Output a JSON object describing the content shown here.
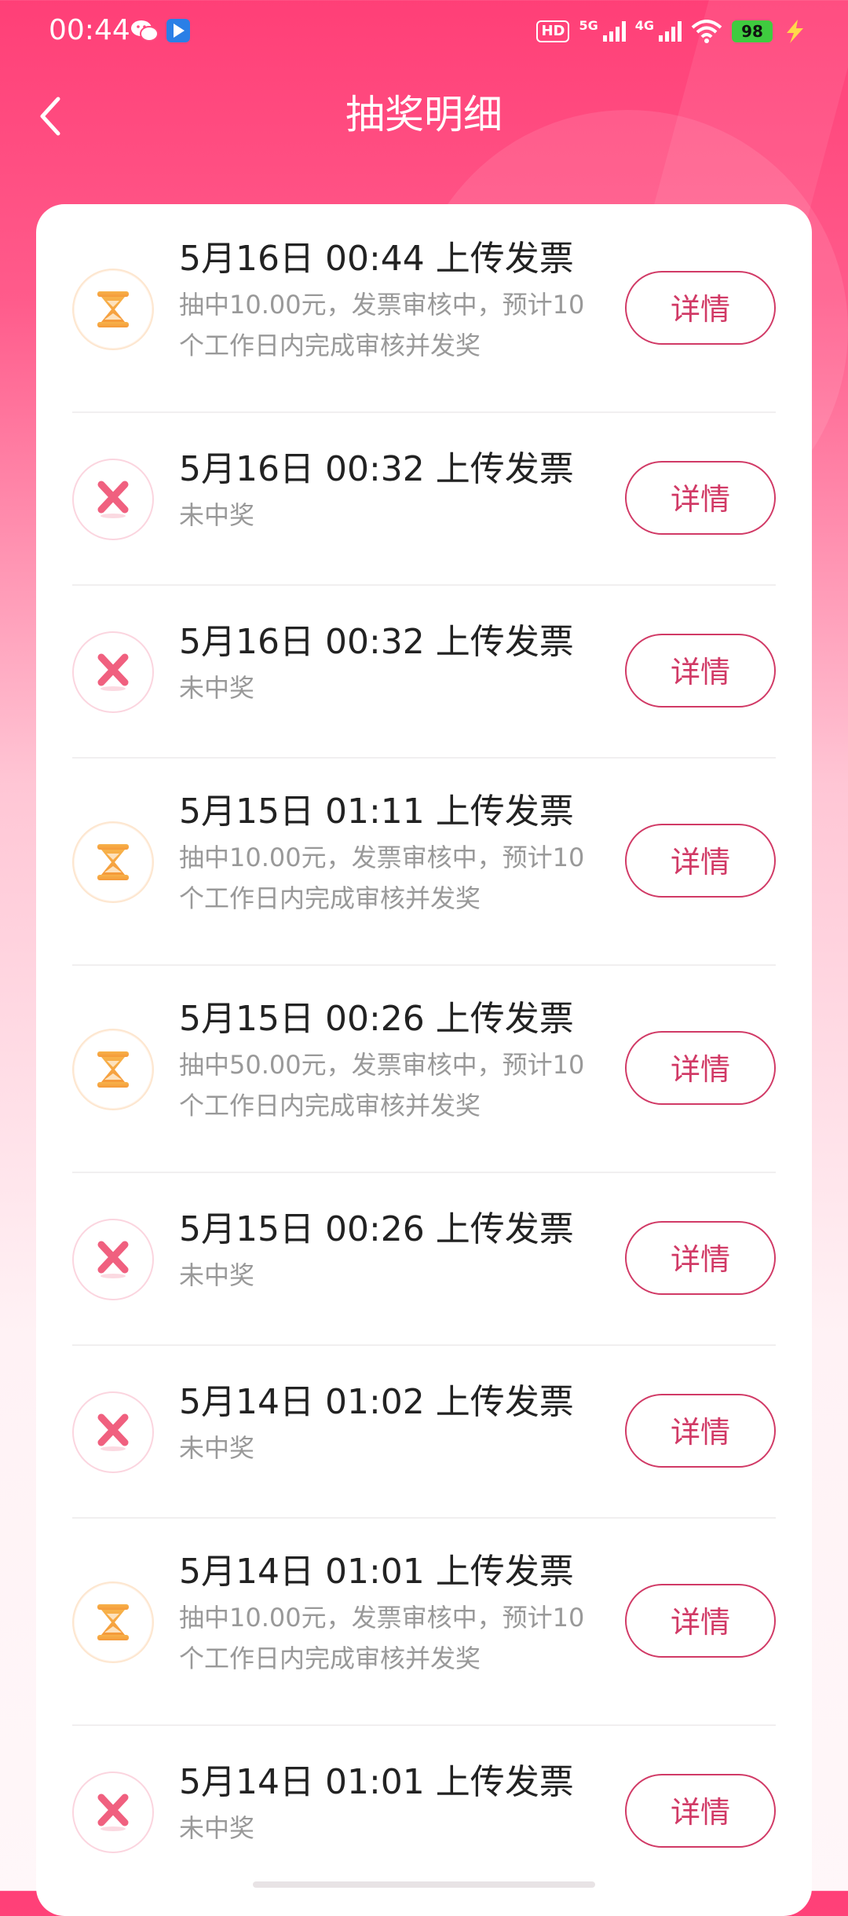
{
  "status_bar": {
    "time": "00:44",
    "net1": "5G",
    "net2": "4G",
    "battery": "98",
    "hd": "HD"
  },
  "nav": {
    "title": "抽奖明细"
  },
  "records": [
    {
      "title": "5月16日 00:44 上传发票",
      "status": "pending",
      "desc": "抽中10.00元，发票审核中，预计10个工作日内完成审核并发奖",
      "button": "详情"
    },
    {
      "title": "5月16日 00:32 上传发票",
      "status": "lost",
      "desc": "未中奖",
      "button": "详情"
    },
    {
      "title": "5月16日 00:32 上传发票",
      "status": "lost",
      "desc": "未中奖",
      "button": "详情"
    },
    {
      "title": "5月15日 01:11 上传发票",
      "status": "pending",
      "desc": "抽中10.00元，发票审核中，预计10个工作日内完成审核并发奖",
      "button": "详情"
    },
    {
      "title": "5月15日 00:26 上传发票",
      "status": "pending",
      "desc": "抽中50.00元，发票审核中，预计10个工作日内完成审核并发奖",
      "button": "详情"
    },
    {
      "title": "5月15日 00:26 上传发票",
      "status": "lost",
      "desc": "未中奖",
      "button": "详情"
    },
    {
      "title": "5月14日 01:02 上传发票",
      "status": "lost",
      "desc": "未中奖",
      "button": "详情"
    },
    {
      "title": "5月14日 01:01 上传发票",
      "status": "pending",
      "desc": "抽中10.00元，发票审核中，预计10个工作日内完成审核并发奖",
      "button": "详情"
    },
    {
      "title": "5月14日 01:01 上传发票",
      "status": "lost",
      "desc": "未中奖",
      "button": "详情"
    }
  ],
  "colors": {
    "accent": "#d13a66",
    "header": "#ff3f77",
    "pending_icon": "#f5a33a",
    "lost_icon": "#f0607f"
  },
  "icons": {
    "pending": "hourglass-icon",
    "lost": "cross-icon",
    "back": "chevron-left-icon"
  }
}
